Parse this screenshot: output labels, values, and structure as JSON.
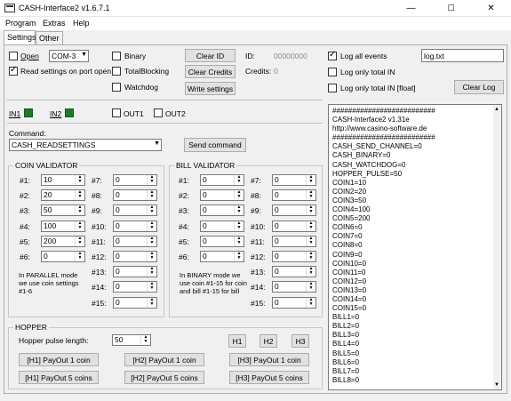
{
  "window": {
    "title": "CASH-Interface2 v1.6.7.1",
    "buttons": {
      "minimize": "—",
      "maximize": "☐",
      "close": "✕"
    }
  },
  "menu": [
    "Program",
    "Extras",
    "Help"
  ],
  "tabs": [
    "Settings",
    "Other"
  ],
  "connection": {
    "open_label": "Open",
    "open_checked": false,
    "port": "COM-3",
    "read_settings_label": "Read settings on port open",
    "read_settings_checked": true,
    "binary_label": "Binary",
    "binary_checked": false,
    "total_blocking_label": "TotalBlocking",
    "total_blocking_checked": false,
    "watchdog_label": "Watchdog",
    "watchdog_checked": false,
    "clear_id_label": "Clear ID",
    "clear_credits_label": "Clear Credits",
    "write_settings_label": "Write settings",
    "id_label": "ID:",
    "id_value": "00000000",
    "credits_label": "Credits:",
    "credits_value": "0"
  },
  "log": {
    "log_all_label": "Log all events",
    "log_all_checked": true,
    "log_file": "log.txt",
    "log_total_in_label": "Log only total IN",
    "log_total_in_checked": false,
    "log_total_float_label": "Log only total IN [float]",
    "log_total_float_checked": false,
    "clear_log_label": "Clear Log",
    "lines": [
      "##########################",
      "CASH-Interface2 v1.31e",
      "http://www.casino-software.de",
      "##########################",
      "CASH_SEND_CHANNEL=0",
      "CASH_BINARY=0",
      "CASH_WATCHDOG=0",
      "HOPPER_PULSE=50",
      "COIN1=10",
      "COIN2=20",
      "COIN3=50",
      "COIN4=100",
      "COIN5=200",
      "COIN6=0",
      "COIN7=0",
      "COIN8=0",
      "COIN9=0",
      "COIN10=0",
      "COIN11=0",
      "COIN12=0",
      "COIN13=0",
      "COIN14=0",
      "COIN15=0",
      "BILL1=0",
      "BILL2=0",
      "BILL3=0",
      "BILL4=0",
      "BILL5=0",
      "BILL6=0",
      "BILL7=0",
      "BILL8=0"
    ]
  },
  "io": {
    "in1_label": "IN1",
    "in2_label": "IN2",
    "out1_label": "OUT1",
    "out1_checked": false,
    "out2_label": "OUT2",
    "out2_checked": false,
    "led_color": "#1e7a26"
  },
  "command": {
    "label": "Command:",
    "value": "CASH_READSETTINGS",
    "send_label": "Send command"
  },
  "coin_validator": {
    "title": "COIN VALIDATOR",
    "left": [
      {
        "label": "#1:",
        "value": "10"
      },
      {
        "label": "#2:",
        "value": "20"
      },
      {
        "label": "#3:",
        "value": "50"
      },
      {
        "label": "#4:",
        "value": "100"
      },
      {
        "label": "#5:",
        "value": "200"
      },
      {
        "label": "#6:",
        "value": "0"
      }
    ],
    "right": [
      {
        "label": "#7:",
        "value": "0"
      },
      {
        "label": "#8:",
        "value": "0"
      },
      {
        "label": "#9:",
        "value": "0"
      },
      {
        "label": "#10:",
        "value": "0"
      },
      {
        "label": "#11:",
        "value": "0"
      },
      {
        "label": "#12:",
        "value": "0"
      },
      {
        "label": "#13:",
        "value": "0"
      },
      {
        "label": "#14:",
        "value": "0"
      },
      {
        "label": "#15:",
        "value": "0"
      }
    ],
    "note": "In PARALLEL mode we use coin settings #1-6"
  },
  "bill_validator": {
    "title": "BILL VALIDATOR",
    "left": [
      {
        "label": "#1:",
        "value": "0"
      },
      {
        "label": "#2:",
        "value": "0"
      },
      {
        "label": "#3:",
        "value": "0"
      },
      {
        "label": "#4:",
        "value": "0"
      },
      {
        "label": "#5:",
        "value": "0"
      },
      {
        "label": "#6:",
        "value": "0"
      }
    ],
    "right": [
      {
        "label": "#7:",
        "value": "0"
      },
      {
        "label": "#8:",
        "value": "0"
      },
      {
        "label": "#9:",
        "value": "0"
      },
      {
        "label": "#10:",
        "value": "0"
      },
      {
        "label": "#11:",
        "value": "0"
      },
      {
        "label": "#12:",
        "value": "0"
      },
      {
        "label": "#13:",
        "value": "0"
      },
      {
        "label": "#14:",
        "value": "0"
      },
      {
        "label": "#15:",
        "value": "0"
      }
    ],
    "note": "In BINARY mode we use coin #1-15 for coin and bill #1-15 for bill"
  },
  "hopper": {
    "title": "HOPPER",
    "pulse_label": "Hopper pulse length:",
    "pulse_value": "50",
    "h1_label": "H1",
    "h2_label": "H2",
    "h3_label": "H3",
    "payout1": [
      "[H1] PayOut 1 coin",
      "[H2] PayOut 1 coin",
      "[H3] PayOut 1 coin"
    ],
    "payout5": [
      "[H1] PayOut 5 coins",
      "[H2] PayOut 5 coins",
      "[H3] PayOut 5 coins"
    ]
  }
}
